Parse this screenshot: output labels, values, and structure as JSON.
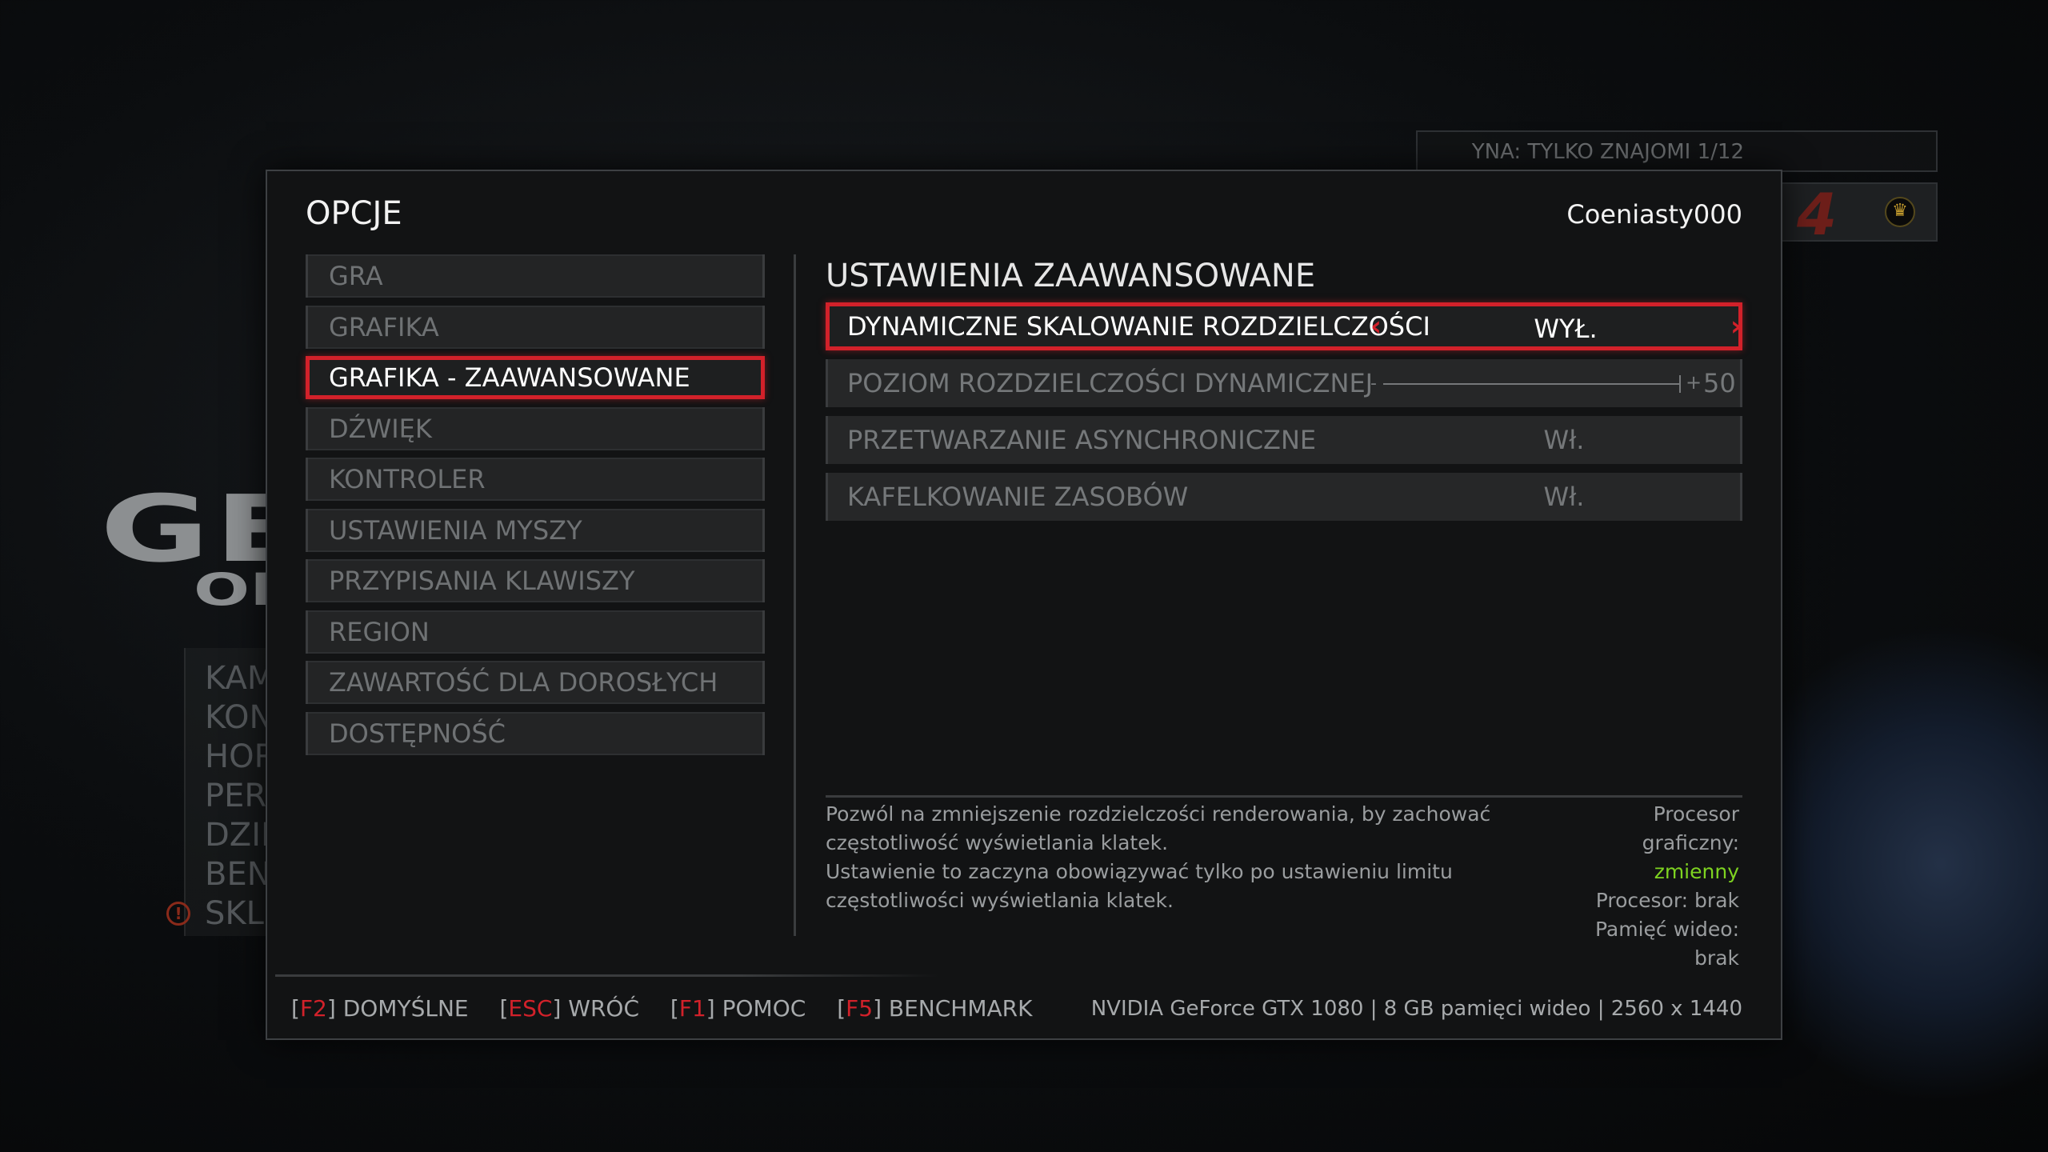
{
  "background": {
    "logo_line1": "GE",
    "logo_line2": "OF",
    "menu_items": [
      "KAM",
      "KON",
      "HOR",
      "PER",
      "DZIE",
      "BEN",
      "SKL"
    ],
    "topbar_text": "YNA: TYLKO ZNAJOMI 1/12",
    "rank_glyph": "4"
  },
  "dialog": {
    "title": "OPCJE",
    "username": "Coeniasty000"
  },
  "nav": {
    "active_index": 2,
    "items": [
      {
        "label": "GRA"
      },
      {
        "label": "GRAFIKA"
      },
      {
        "label": "GRAFIKA - ZAAWANSOWANE"
      },
      {
        "label": "DŹWIĘK"
      },
      {
        "label": "KONTROLER"
      },
      {
        "label": "USTAWIENIA MYSZY"
      },
      {
        "label": "PRZYPISANIA KLAWISZY"
      },
      {
        "label": "REGION"
      },
      {
        "label": "ZAWARTOŚĆ DLA DOROSŁYCH"
      },
      {
        "label": "DOSTĘPNOŚĆ"
      }
    ]
  },
  "settings": {
    "section_title": "USTAWIENIA ZAAWANSOWANE",
    "items": [
      {
        "label": "DYNAMICZNE SKALOWANIE ROZDZIELCZOŚCI",
        "value": "WYŁ."
      },
      {
        "label": "POZIOM ROZDZIELCZOŚCI DYNAMICZNEJ",
        "slider_min": "-",
        "slider_plus": "+",
        "value": "50",
        "slider_fraction": 1.0
      },
      {
        "label": "PRZETWARZANIE ASYNCHRONICZNE",
        "value": "Wł."
      },
      {
        "label": "KAFELKOWANIE ZASOBÓW",
        "value": "Wł."
      }
    ]
  },
  "description": {
    "line1": "Pozwól na zmniejszenie rozdzielczości renderowania, by zachować częstotliwość wyświetlania klatek.",
    "line2": "Ustawienie to zaczyna obowiązywać tylko po ustawieniu limitu częstotliwości wyświetlania klatek."
  },
  "hardware": {
    "gpu_label": "Procesor graficzny:",
    "gpu_value": "zmienny",
    "cpu_label": "Procesor:",
    "cpu_value": "brak",
    "vram_label": "Pamięć wideo:",
    "vram_value": "brak"
  },
  "footer": {
    "keys": [
      {
        "key": "F2",
        "label": "DOMYŚLNE"
      },
      {
        "key": "ESC",
        "label": "WRÓĆ"
      },
      {
        "key": "F1",
        "label": "POMOC"
      },
      {
        "key": "F5",
        "label": "BENCHMARK"
      }
    ],
    "gpu_info": "NVIDIA GeForce GTX 1080 | 8 GB pamięci wideo | 2560 x 1440"
  },
  "colors": {
    "accent": "#d2212a",
    "highlight_green": "#7ed321",
    "panel_bg": "#121314"
  },
  "icons": {
    "arrow_left": "chevron-left-icon",
    "arrow_right": "chevron-right-icon",
    "crown": "crown-icon",
    "warning": "warning-icon"
  }
}
